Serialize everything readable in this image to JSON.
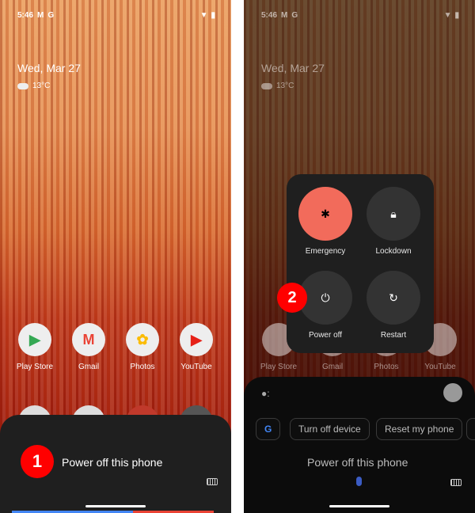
{
  "status": {
    "time": "5:46"
  },
  "lockscreen": {
    "date": "Wed, Mar 27",
    "temp": "13°C"
  },
  "apps": [
    {
      "label": "Play Store",
      "icon": "play-store-icon"
    },
    {
      "label": "Gmail",
      "icon": "gmail-icon"
    },
    {
      "label": "Photos",
      "icon": "photos-icon"
    },
    {
      "label": "YouTube",
      "icon": "youtube-icon"
    }
  ],
  "left": {
    "query": "Power off this phone",
    "badge": "1"
  },
  "power_menu": {
    "emergency": "Emergency",
    "lockdown": "Lockdown",
    "power_off": "Power off",
    "restart": "Restart",
    "badge": "2",
    "emergency_color": "#f26b5b"
  },
  "assistant": {
    "chips": [
      "Turn off device",
      "Reset my phone"
    ],
    "query": "Power off this phone"
  }
}
